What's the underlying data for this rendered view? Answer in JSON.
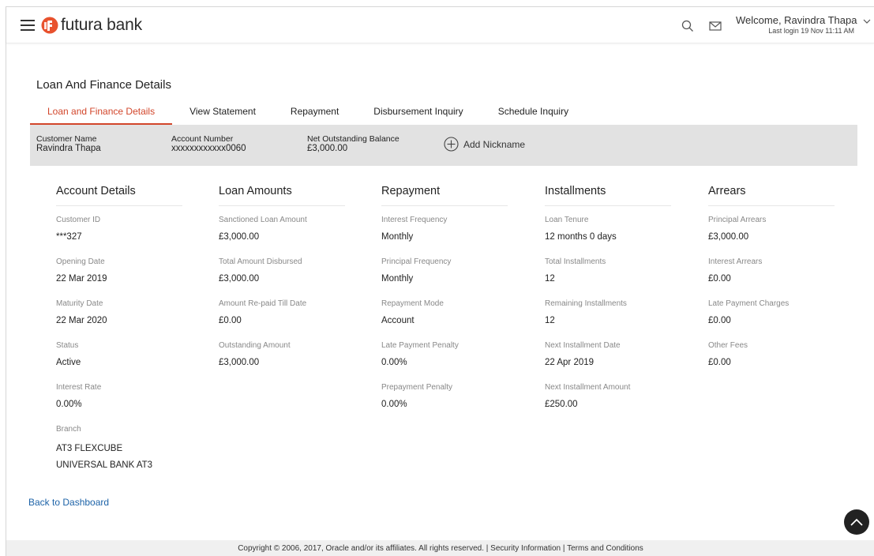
{
  "header": {
    "brand": "futura bank",
    "welcome": "Welcome, Ravindra Thapa",
    "last_login": "Last login 19 Nov 11:11 AM",
    "icons": [
      "hamburger-menu-icon",
      "search-icon",
      "mail-icon",
      "chevron-down-icon"
    ],
    "brand_color": "#e8522e"
  },
  "page": {
    "title": "Loan And Finance Details",
    "tabs": [
      {
        "label": "Loan and Finance Details",
        "active": true
      },
      {
        "label": "View Statement",
        "active": false
      },
      {
        "label": "Repayment",
        "active": false
      },
      {
        "label": "Disbursement Inquiry",
        "active": false
      },
      {
        "label": "Schedule Inquiry",
        "active": false
      }
    ],
    "accent_color": "#d2462b"
  },
  "summary": {
    "customer_name_label": "Customer Name",
    "customer_name": "Ravindra Thapa",
    "account_number_label": "Account Number",
    "account_number": "xxxxxxxxxxxx0060",
    "balance_label": "Net Outstanding Balance",
    "balance": "£3,000.00",
    "add_nickname": "Add Nickname"
  },
  "sections": {
    "account": {
      "title": "Account Details",
      "fields": [
        {
          "label": "Customer ID",
          "value": "***327"
        },
        {
          "label": "Opening Date",
          "value": "22 Mar 2019"
        },
        {
          "label": "Maturity Date",
          "value": "22 Mar 2020"
        },
        {
          "label": "Status",
          "value": "Active"
        },
        {
          "label": "Interest Rate",
          "value": "0.00%"
        },
        {
          "label": "Branch",
          "value": "AT3 FLEXCUBE UNIVERSAL BANK AT3"
        }
      ]
    },
    "loan": {
      "title": "Loan Amounts",
      "fields": [
        {
          "label": "Sanctioned Loan Amount",
          "value": "£3,000.00"
        },
        {
          "label": "Total Amount Disbursed",
          "value": "£3,000.00"
        },
        {
          "label": "Amount Re-paid Till Date",
          "value": "£0.00"
        },
        {
          "label": "Outstanding Amount",
          "value": "£3,000.00"
        }
      ]
    },
    "repayment": {
      "title": "Repayment",
      "fields": [
        {
          "label": "Interest Frequency",
          "value": "Monthly"
        },
        {
          "label": "Principal Frequency",
          "value": "Monthly"
        },
        {
          "label": "Repayment Mode",
          "value": "Account"
        },
        {
          "label": "Late Payment Penalty",
          "value": "0.00%"
        },
        {
          "label": "Prepayment Penalty",
          "value": "0.00%"
        }
      ]
    },
    "installments": {
      "title": "Installments",
      "fields": [
        {
          "label": "Loan Tenure",
          "value": "12 months 0 days"
        },
        {
          "label": "Total Installments",
          "value": "12"
        },
        {
          "label": "Remaining Installments",
          "value": "12"
        },
        {
          "label": "Next Installment Date",
          "value": "22 Apr 2019"
        },
        {
          "label": "Next Installment Amount",
          "value": "£250.00"
        }
      ]
    },
    "arrears": {
      "title": "Arrears",
      "fields": [
        {
          "label": "Principal Arrears",
          "value": "£3,000.00"
        },
        {
          "label": "Interest Arrears",
          "value": "£0.00"
        },
        {
          "label": "Late Payment Charges",
          "value": "£0.00"
        },
        {
          "label": "Other Fees",
          "value": "£0.00"
        }
      ]
    }
  },
  "back_link": "Back to Dashboard",
  "footer": {
    "copyright": "Copyright © 2006, 2017, Oracle and/or its affiliates. All rights reserved.",
    "separator": "|",
    "security": "Security Information",
    "terms": "Terms and Conditions"
  }
}
